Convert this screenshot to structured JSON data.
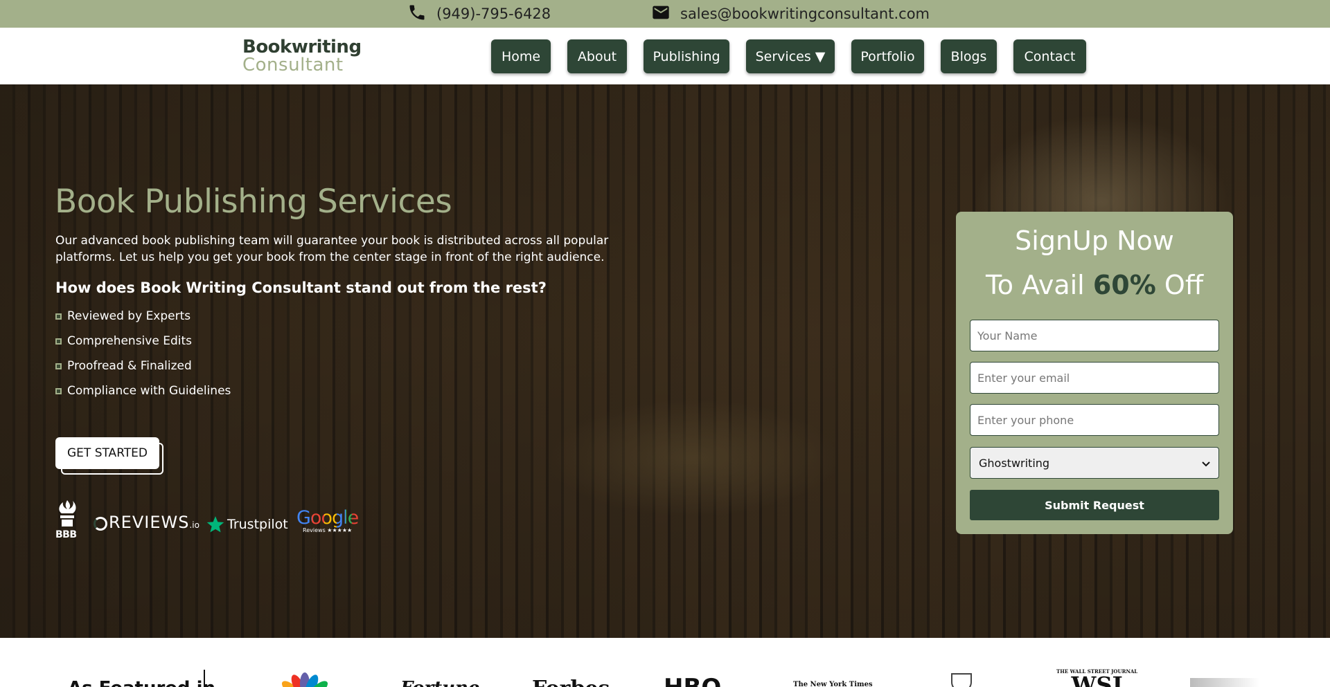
{
  "topbar": {
    "phone": "(949)-795-6428",
    "phone_icon": "phone-icon",
    "email": "sales@bookwritingconsultant.com",
    "email_icon": "mail-icon"
  },
  "brand": {
    "logo_top": "Bookwriting",
    "logo_bottom": "Consultant",
    "accent": "#a3b08a",
    "dark": "#2e4636"
  },
  "nav": {
    "items": [
      {
        "label": "Home"
      },
      {
        "label": "About"
      },
      {
        "label": "Publishing"
      },
      {
        "label": "Services ▼"
      },
      {
        "label": "Portfolio"
      },
      {
        "label": "Blogs"
      },
      {
        "label": "Contact"
      }
    ]
  },
  "hero": {
    "title": "Book Publishing Services",
    "description": "Our advanced book publishing team will guarantee your book is distributed across all popular platforms. Let us help you get your book from the center stage in front of the right audience.",
    "question": "How does Book Writing Consultant stand out from the rest?",
    "features": [
      "Reviewed by Experts",
      "Comprehensive Edits",
      "Proofread & Finalized",
      "Compliance with Guidelines"
    ],
    "cta": "GET STARTED",
    "badges": {
      "bbb": "BBB",
      "reviews": "REVIEWS",
      "reviews_suffix": ".io",
      "trustpilot": "Trustpilot",
      "google": "Google",
      "google_sub": "Reviews ★★★★★"
    }
  },
  "signup": {
    "title": "SignUp Now",
    "sub_prefix": "To Avail",
    "sub_highlight": "60%",
    "sub_suffix": "Off",
    "name_placeholder": "Your Name",
    "email_placeholder": "Enter your email",
    "phone_placeholder": "Enter your phone",
    "service_selected": "Ghostwriting",
    "submit": "Submit Request"
  },
  "featured": {
    "label": "As Featured in",
    "logos": [
      "NBC",
      "Fortune",
      "Forbes",
      "HBO",
      "The New York Times",
      "Harvard",
      "WSJ"
    ],
    "wsj_top": "THE WALL STREET JOURNAL",
    "wsj": "WSJ"
  }
}
